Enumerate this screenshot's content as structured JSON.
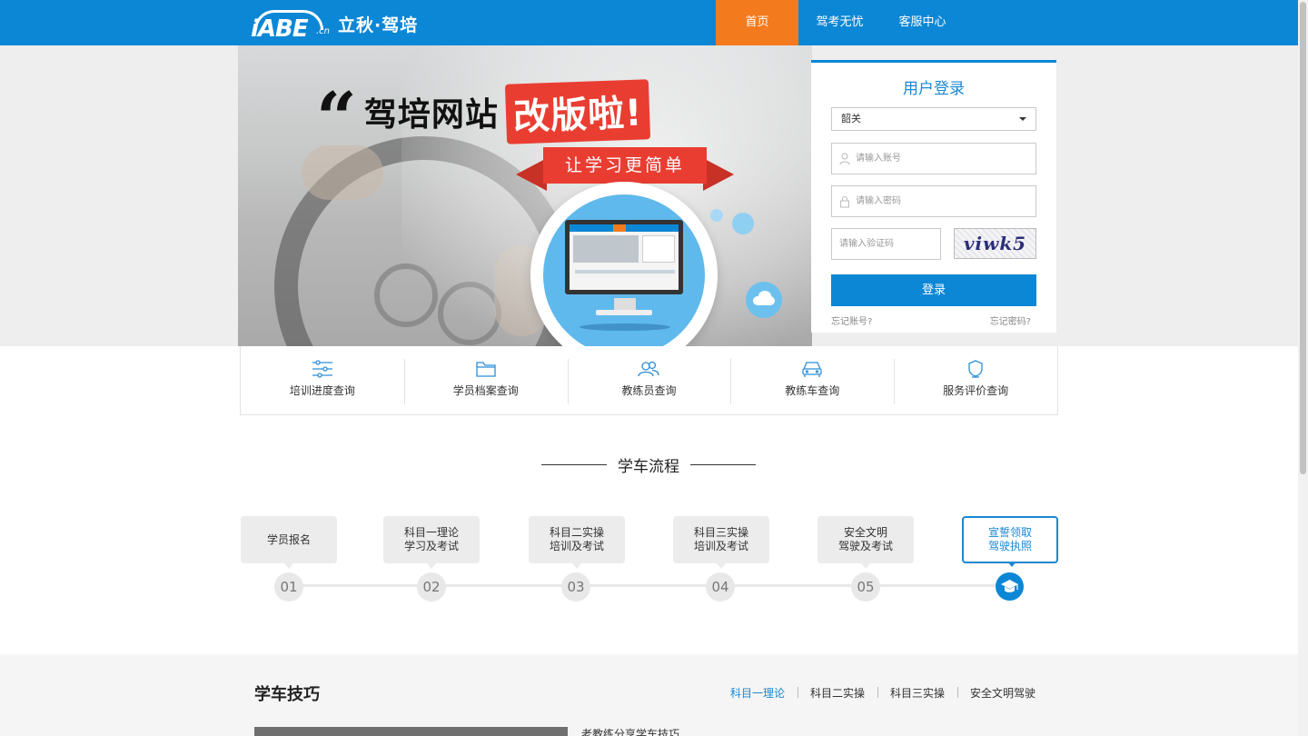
{
  "header": {
    "logo_letters": "iABE",
    "logo_suffix": ".cn",
    "logo_text": "立秋·驾培",
    "nav": [
      "首页",
      "驾考无忧",
      "客服中心"
    ]
  },
  "banner": {
    "headline_black": "驾培网站",
    "headline_red": "改版啦!",
    "ribbon": "让学习更简单"
  },
  "login": {
    "title": "用户登录",
    "city": "韶关",
    "account_placeholder": "请输入账号",
    "password_placeholder": "请输入密码",
    "captcha_placeholder": "请输入验证码",
    "captcha_text": "viwk5",
    "submit": "登录",
    "forgot_account": "忘记账号?",
    "forgot_password": "忘记密码?"
  },
  "queries": [
    {
      "label": "培训进度查询",
      "icon": "sliders-icon"
    },
    {
      "label": "学员档案查询",
      "icon": "folder-icon"
    },
    {
      "label": "教练员查询",
      "icon": "users-icon"
    },
    {
      "label": "教练车查询",
      "icon": "car-icon"
    },
    {
      "label": "服务评价查询",
      "icon": "badge-icon"
    }
  ],
  "process": {
    "title": "学车流程",
    "steps": [
      {
        "line1": "学员报名",
        "line2": "",
        "num": "01"
      },
      {
        "line1": "科目一理论",
        "line2": "学习及考试",
        "num": "02"
      },
      {
        "line1": "科目二实操",
        "line2": "培训及考试",
        "num": "03"
      },
      {
        "line1": "科目三实操",
        "line2": "培训及考试",
        "num": "04"
      },
      {
        "line1": "安全文明",
        "line2": "驾驶及考试",
        "num": "05"
      },
      {
        "line1": "宣誓领取",
        "line2": "驾驶执照",
        "num": ""
      }
    ]
  },
  "tips": {
    "title": "学车技巧",
    "tabs": [
      "科目一理论",
      "科目二实操",
      "科目三实操",
      "安全文明驾驶"
    ],
    "article_preview": "老教练分享学车技巧"
  },
  "colors": {
    "primary": "#0c87d6",
    "accent_orange": "#f47a1e",
    "banner_red": "#ea3d32"
  }
}
